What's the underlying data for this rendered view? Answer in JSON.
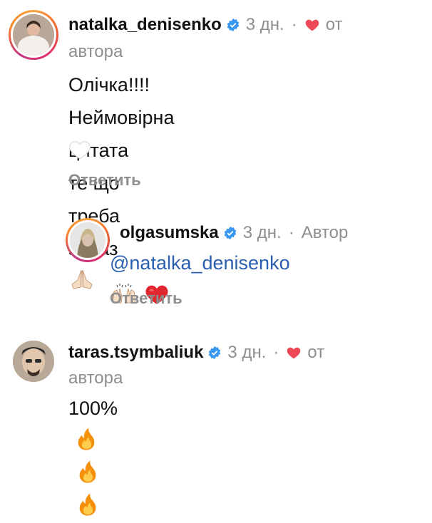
{
  "comments": [
    {
      "username": "natalka_denisenko",
      "time": "3 дн.",
      "dot": "·",
      "liked_by_author": "от",
      "liked_by_author_2": "автора",
      "line1": "Олічка!!!! Неймовірна",
      "line2": "І цитата те що треба зараз",
      "reply_label": "Ответить"
    },
    {
      "username": "olgasumska",
      "time": "3 дн.",
      "dot": "·",
      "author_badge": "Автор",
      "mention": "@natalka_denisenko",
      "reply_label": "Ответить"
    },
    {
      "username": "taras.tsymbaliuk",
      "time": "3 дн.",
      "dot": "·",
      "liked_by_author": "от",
      "liked_by_author_2": "автора",
      "text": "100%"
    }
  ],
  "colors": {
    "verified": "#3897f0",
    "heart": "#ed4956",
    "mention": "#2a5fb0",
    "muted": "#8e8e8e"
  },
  "icons": [
    "verified-badge-icon",
    "heart-icon",
    "white-heart-icon",
    "folded-hands-icon",
    "raising-hands-icon",
    "fire-icon"
  ]
}
